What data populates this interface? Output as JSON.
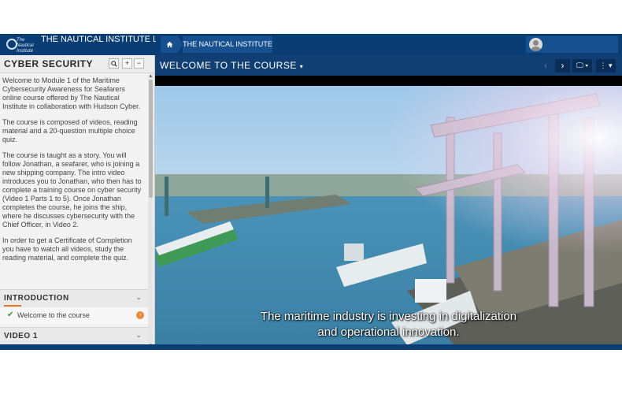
{
  "header": {
    "logo_text": "The Nautical Institute",
    "site_title": "THE NAUTICAL INSTITUTE LEARNING MANAGEMENT SYSTEM",
    "home_icon": "home-icon",
    "breadcrumb": "THE NAUTICAL INSTITUTE",
    "avatar_icon": "user-avatar-icon"
  },
  "sidebar": {
    "title": "CYBER SECURITY",
    "buttons": {
      "search": "🔍",
      "expand": "+",
      "collapse": "−"
    },
    "paragraphs": [
      "Welcome to Module 1 of the Maritime Cybersecurity Awareness for Seafarers online course offered by The Nautical Institute in collaboration with Hudson Cyber.",
      "The course is composed of videos, reading material and a 20-question multiple choice quiz.",
      "The course is taught as a story. You will follow Jonathan, a seafarer, who is joining a new shipping company. The intro video introduces you to Jonathan, who then has to complete a training course on cyber security (Video 1 Parts 1 to 5). Once Jonathan completes the course, he joins the ship, where he discusses cybersecurity with the Chief Officer, in Video 2.",
      "In order to get a Certificate of Completion you have to watch all videos, study the reading material, and complete the quiz."
    ],
    "sections": [
      {
        "label": "INTRODUCTION",
        "expanded": true
      },
      {
        "label": "VIDEO 1",
        "expanded": false
      }
    ],
    "lesson": {
      "label": "Welcome to the course",
      "completed": true
    }
  },
  "content": {
    "title": "WELCOME TO THE COURSE",
    "nav": {
      "prev": "‹",
      "next": "›",
      "display": "🖵 ▾",
      "more": "⋮ ▾"
    }
  },
  "video": {
    "subtitle_line1": "The maritime industry is investing in digitalization",
    "subtitle_line2": "and operational innovation."
  },
  "colors": {
    "header_blue": "#0b3d75",
    "accent_orange": "#e87722",
    "check_green": "#3a9a3a"
  }
}
